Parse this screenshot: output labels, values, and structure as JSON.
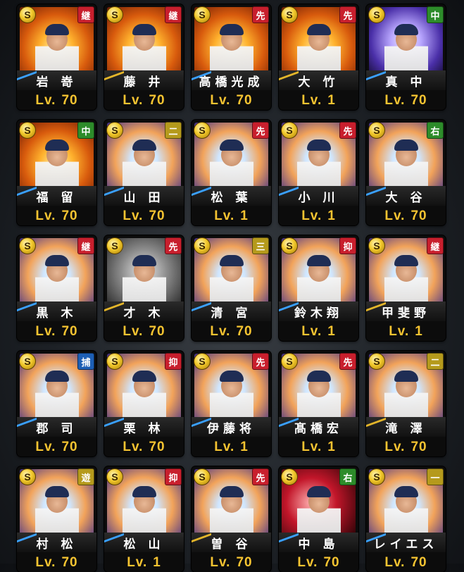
{
  "coin_label": "S",
  "level_prefix": "Lv.",
  "cards": [
    {
      "name": "岩 嵜",
      "pos": "継",
      "pos_type": "relief",
      "level": "70",
      "bg": "fire",
      "deco": "blue"
    },
    {
      "name": "藤 井",
      "pos": "継",
      "pos_type": "relief",
      "level": "70",
      "bg": "fire",
      "deco": "gold"
    },
    {
      "name": "高橋光成",
      "pos": "先",
      "pos_type": "start",
      "level": "70",
      "bg": "fire",
      "deco": "blue"
    },
    {
      "name": "大 竹",
      "pos": "先",
      "pos_type": "start",
      "level": "1",
      "bg": "fire",
      "deco": "gold"
    },
    {
      "name": "真 中",
      "pos": "中",
      "pos_type": "field",
      "level": "70",
      "bg": "purple",
      "deco": "blue"
    },
    {
      "name": "福 留",
      "pos": "中",
      "pos_type": "field",
      "level": "70",
      "bg": "fire",
      "deco": "blue"
    },
    {
      "name": "山 田",
      "pos": "二",
      "pos_type": "infield",
      "level": "70",
      "bg": "spark",
      "deco": "blue"
    },
    {
      "name": "松 葉",
      "pos": "先",
      "pos_type": "start",
      "level": "1",
      "bg": "spark",
      "deco": "blue"
    },
    {
      "name": "小 川",
      "pos": "先",
      "pos_type": "start",
      "level": "1",
      "bg": "spark",
      "deco": "blue"
    },
    {
      "name": "大 谷",
      "pos": "右",
      "pos_type": "field",
      "level": "70",
      "bg": "spark",
      "deco": "blue"
    },
    {
      "name": "黒 木",
      "pos": "継",
      "pos_type": "relief",
      "level": "70",
      "bg": "spark",
      "deco": "blue"
    },
    {
      "name": "才 木",
      "pos": "先",
      "pos_type": "start",
      "level": "70",
      "bg": "gray",
      "deco": "gold"
    },
    {
      "name": "清 宮",
      "pos": "三",
      "pos_type": "infield",
      "level": "70",
      "bg": "spark",
      "deco": "blue"
    },
    {
      "name": "鈴木翔",
      "pos": "抑",
      "pos_type": "close",
      "level": "1",
      "bg": "spark",
      "deco": "blue"
    },
    {
      "name": "甲斐野",
      "pos": "継",
      "pos_type": "relief",
      "level": "1",
      "bg": "spark",
      "deco": "gold"
    },
    {
      "name": "郡 司",
      "pos": "捕",
      "pos_type": "catch",
      "level": "70",
      "bg": "spark",
      "deco": "blue"
    },
    {
      "name": "栗 林",
      "pos": "抑",
      "pos_type": "close",
      "level": "70",
      "bg": "spark",
      "deco": "blue"
    },
    {
      "name": "伊藤将",
      "pos": "先",
      "pos_type": "start",
      "level": "1",
      "bg": "spark",
      "deco": "blue"
    },
    {
      "name": "髙橋宏",
      "pos": "先",
      "pos_type": "start",
      "level": "1",
      "bg": "spark",
      "deco": "blue"
    },
    {
      "name": "滝 澤",
      "pos": "二",
      "pos_type": "infield",
      "level": "70",
      "bg": "spark",
      "deco": "gold"
    },
    {
      "name": "村 松",
      "pos": "遊",
      "pos_type": "infield",
      "level": "70",
      "bg": "spark",
      "deco": "blue"
    },
    {
      "name": "松 山",
      "pos": "抑",
      "pos_type": "close",
      "level": "1",
      "bg": "spark",
      "deco": "blue"
    },
    {
      "name": "曽 谷",
      "pos": "先",
      "pos_type": "start",
      "level": "70",
      "bg": "spark",
      "deco": "gold"
    },
    {
      "name": "中 島",
      "pos": "右",
      "pos_type": "field",
      "level": "70",
      "bg": "red",
      "deco": "blue"
    },
    {
      "name": "レイエス",
      "pos": "一",
      "pos_type": "infield",
      "level": "70",
      "bg": "spark",
      "deco": "blue"
    }
  ]
}
